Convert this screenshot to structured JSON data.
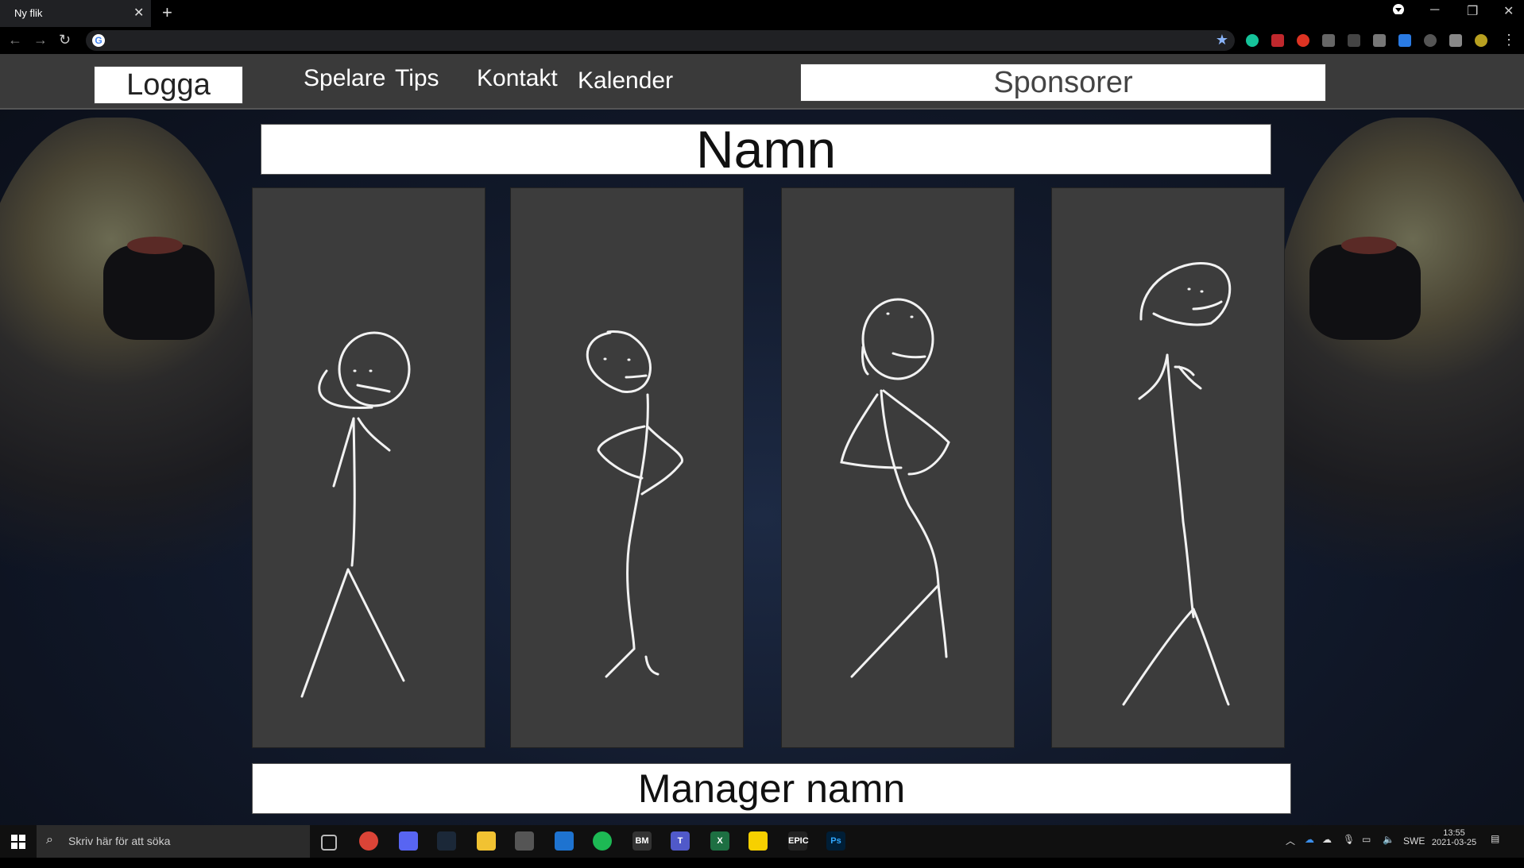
{
  "browser": {
    "tab_title": "Ny flik",
    "tab_close": "✕",
    "new_tab": "+",
    "window_controls": [
      "─",
      "❐",
      "✕"
    ],
    "address_value": ""
  },
  "site": {
    "logo_label": "Logga",
    "nav": [
      "Spelare",
      "Tips",
      "Kontakt",
      "Kalender"
    ],
    "sponsors_label": "Sponsorer",
    "title": "Namn",
    "manager_label": "Manager namn",
    "player_cards": 4
  },
  "taskbar": {
    "search_placeholder": "Skriv här för att söka",
    "language": "SWE",
    "time": "13:55",
    "date": "2021-03-25",
    "pinned_apps": [
      "task-view",
      "chrome",
      "discord",
      "steam",
      "file-explorer",
      "app",
      "mail",
      "spotify",
      "app-bm",
      "teams",
      "excel",
      "sticky-notes",
      "epic-games",
      "photoshop"
    ]
  },
  "colors": {
    "navbar": "#3a3a3a",
    "card": "#3c3c3c",
    "accent_white": "#ffffff"
  }
}
